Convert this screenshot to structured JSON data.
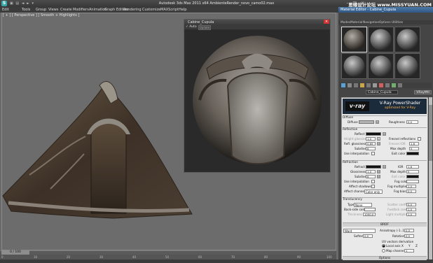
{
  "app": {
    "window_title": "Autodesk 3ds Max 2011 x64    AmbienteRender_novo_camo02.max",
    "quick_tools": "▣ ▤ ◄ ►  ▾",
    "watermark": "思缘设计论坛 www.MISSYUAN.COM",
    "window_buttons": "– □ ×"
  },
  "menu": [
    "Edit",
    "Tools",
    "Group",
    "Views",
    "Create",
    "Modifiers",
    "Animation",
    "Graph Editors",
    "Rendering",
    "Customize",
    "MAXScript",
    "Help"
  ],
  "viewport": {
    "label": "[ + ] [ Perspective ] [ Smooth + Highlights ]"
  },
  "timeline": {
    "slider_label": "0 / 100",
    "ticks": [
      "0",
      "10",
      "20",
      "30",
      "40",
      "50",
      "60",
      "70",
      "80",
      "90",
      "100"
    ]
  },
  "render_window": {
    "title": "Cabine_Cupula",
    "close": "×",
    "auto_label": "Auto",
    "auto_checked": "✓",
    "update_label": "Update"
  },
  "material_editor": {
    "title": "Material Editor - Cabine_Cupula",
    "menu": [
      "Modes",
      "Material",
      "Navigation",
      "Options",
      "Utilities"
    ],
    "material_name": "Cabine_Cupula",
    "material_type": "VRayMtl",
    "banner_logo": "v·ray",
    "banner_title": "V-Ray PowerShader",
    "banner_subtitle": "optimized for V-Ray",
    "diffuse": {
      "section": "Diffuse",
      "diffuse_label": "Diffuse",
      "roughness_label": "Roughness",
      "roughness_value": "0,0"
    },
    "reflection": {
      "section": "Reflection",
      "reflect_label": "Reflect",
      "hilight_gloss_label": "Hilight glossiness",
      "hilight_gloss_value": "1,0",
      "l_btn": "L",
      "fresnel_label": "Fresnel reflections",
      "refl_gloss_label": "Refl. glossiness",
      "refl_gloss_value": "0,65",
      "fresnel_ior_label": "Fresnel IOR",
      "fresnel_ior_value": "1,6",
      "subdivs_label": "Subdivs",
      "subdivs_value": "8",
      "max_depth_label": "Max depth",
      "max_depth_value": "5",
      "use_interp_label": "Use interpolation",
      "exit_color_label": "Exit color"
    },
    "refraction": {
      "section": "Refraction",
      "refract_label": "Refract",
      "ior_label": "IOR",
      "ior_value": "1,6",
      "glossiness_label": "Glossiness",
      "glossiness_value": "1,0",
      "max_depth_label": "Max depth",
      "max_depth_value": "5",
      "subdivs_label": "Subdivs",
      "subdivs_value": "8",
      "exit_color_label": "Exit color",
      "use_interp_label": "Use interpolation",
      "fog_color_label": "Fog color",
      "affect_shadows_label": "Affect shadows",
      "fog_mult_label": "Fog multiplier",
      "fog_mult_value": "1,0",
      "affect_channels_label": "Affect channels",
      "affect_channels_value": "Color only",
      "fog_bias_label": "Fog bias",
      "fog_bias_value": "0,0"
    },
    "translucency": {
      "section": "Translucency",
      "type_label": "Type",
      "type_value": "None",
      "scatter_coeff_label": "Scatter coeff",
      "scatter_coeff_value": "0,0",
      "back_side_label": "Back-side color",
      "fwd_bck_label": "Fwd/bck coeff",
      "fwd_bck_value": "1,0",
      "thickness_label": "Thickness",
      "thickness_value": "1000,0",
      "light_mult_label": "Light multiplier",
      "light_mult_value": "1,0"
    },
    "brdf": {
      "section": "BRDF",
      "type_value": "Ward",
      "anisotropy_label": "Anisotropy (-1..1)",
      "anisotropy_value": "0,0",
      "soften_label": "Soften",
      "soften_value": "0,0",
      "rotation_label": "Rotation",
      "rotation_value": "0,0",
      "uv_label": "UV vectors derivation",
      "local_axis_label": "Local axis",
      "axis_x": "X",
      "axis_y": "Y",
      "axis_z": "Z",
      "map_channel_label": "Map channel",
      "map_channel_value": "1"
    },
    "options_section": "Options"
  },
  "colors": {
    "accent": "#3a6b9f",
    "viewport_bg": "#6c6c6c",
    "panel_bg": "#e9e9e9"
  }
}
